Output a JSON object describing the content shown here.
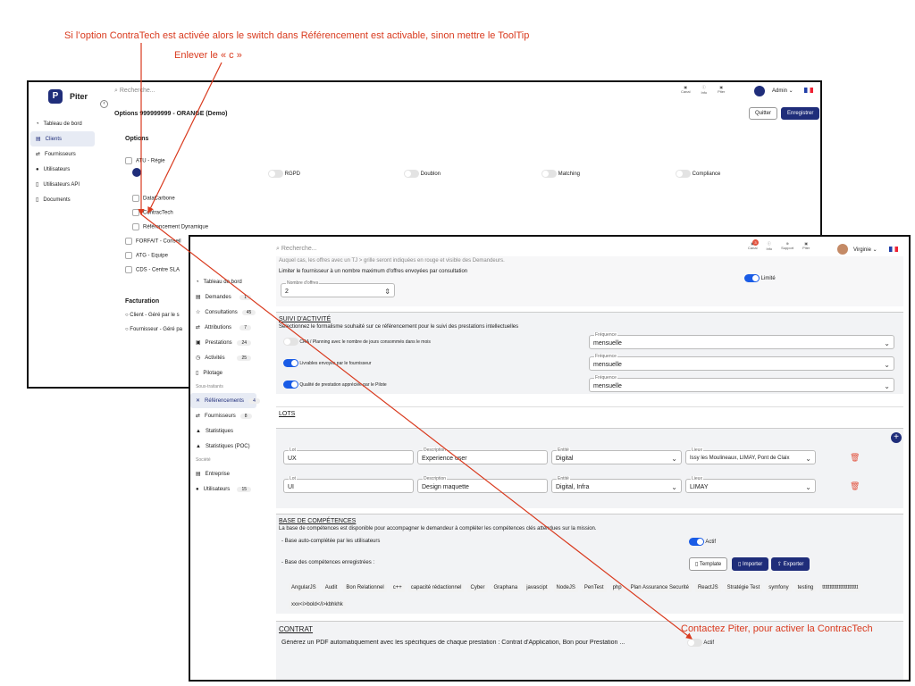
{
  "annotations": {
    "top": "Si l’option ContraTech est activée alors le switch dans Référencement est activable, sinon mettre le ToolTip",
    "second": "Enlever le « c »",
    "contact": "Contactez Piter, pour activer la ContracTech"
  },
  "back": {
    "brand": "Piter",
    "search_placeholder": "Recherche...",
    "header_icons": [
      "Canal",
      "Info",
      "Piter"
    ],
    "user": "Admin",
    "title": "Options 999999999 - ORANGE (Demo)",
    "quit": "Quitter",
    "save": "Enregistrer",
    "nav": [
      "Tableau de bord",
      "Clients",
      "Fournisseurs",
      "Utilisateurs",
      "Utilisateurs API",
      "Documents"
    ],
    "options_title": "Options",
    "atu": "ATU - Régie",
    "toggles": [
      "RGPD",
      "Doublon",
      "Matching",
      "Compliance"
    ],
    "checks": [
      "DataCarbone",
      "ContracTech",
      "Référencement Dynamique"
    ],
    "forfaits": [
      "FORFAIT - Conseil",
      "ATG - Equipe",
      "CDS - Centre SLA"
    ],
    "facturation_title": "Facturation",
    "facturation": [
      "Client - Géré par le s",
      "Fournisseur - Géré pa"
    ]
  },
  "front": {
    "search_placeholder": "Recherche...",
    "header_icons": [
      "Canal",
      "Info",
      "Support",
      "Piter"
    ],
    "canal_count": "3",
    "user": "Virginie",
    "nav_main": [
      {
        "label": "Tableau de bord",
        "count": ""
      },
      {
        "label": "Demandes",
        "count": "1"
      },
      {
        "label": "Consultations",
        "count": "45"
      },
      {
        "label": "Attributions",
        "count": "7"
      },
      {
        "label": "Prestations",
        "count": "24"
      },
      {
        "label": "Activités",
        "count": "25"
      },
      {
        "label": "Pilotage",
        "count": ""
      }
    ],
    "group_sous_traitants": "Sous-traitants",
    "nav_st": [
      {
        "label": "Référencements",
        "count": "4"
      },
      {
        "label": "Fournisseurs",
        "count": "8"
      },
      {
        "label": "Statistiques",
        "count": ""
      },
      {
        "label": "Statistiques (POC)",
        "count": ""
      }
    ],
    "group_societe": "Société",
    "nav_soc": [
      {
        "label": "Entreprise",
        "count": ""
      },
      {
        "label": "Utilisateurs",
        "count": "15"
      }
    ],
    "top_text": "Auquel cas, les offres avec un TJ > grille seront indiquées en rouge et visible des Demandeurs.",
    "limit_text": "Limiter le fournisseur à un nombre maximum d'offres envoyées par consultation",
    "limit_label": "Nombre d'offres",
    "limit_value": "2",
    "limite": "Limité",
    "suivi_title": "SUIVI D'ACTIVITÉ",
    "suivi_sub": "Sélectionnez le formalisme souhaité sur ce référencement pour le suivi des prestations intellectuelles",
    "freq_label": "Fréquence",
    "suivi_rows": [
      {
        "label": "CRA / Planning avec le nombre de jours consommés dans le mois",
        "freq": "mensuelle"
      },
      {
        "label": "Livrables envoyés par le fournisseur",
        "freq": "mensuelle"
      },
      {
        "label": "Qualité de prestation appréciée par le Pilote",
        "freq": "mensuelle"
      }
    ],
    "lots_title": "LOTS",
    "lot_labels": {
      "lot": "Lot",
      "desc": "Description",
      "entite": "Entité",
      "lieux": "Lieux"
    },
    "lots": [
      {
        "lot": "UX",
        "desc": "Experience user",
        "entite": "Digital",
        "lieux": "Issy les Moulineaux, LIMAY, Pont de Claix"
      },
      {
        "lot": "UI",
        "desc": "Design maquette",
        "entite": "Digital, Infra",
        "lieux": "LIMAY"
      }
    ],
    "base_title": "BASE DE COMPÉTENCES",
    "base_sub": "La base de compétences est disponible pour accompagner le demandeur à compléter les compétences clés attendues sur la mission.",
    "auto_label": "- Base auto-complétée par les utilisateurs",
    "actif": "Actif",
    "registered_label": "- Base des compétences enregistrées :",
    "btn_template": "Template",
    "btn_import": "Importer",
    "btn_export": "Exporter",
    "tags": [
      "AngularJS",
      "Audit",
      "Bon Relationnel",
      "c++",
      "capacité rédactionnel",
      "Cyber",
      "Graphana",
      "javascipt",
      "NodeJS",
      "PenTest",
      "php",
      "Plan Assurance Securité",
      "ReactJS",
      "Stratégie Test",
      "symfony",
      "testing",
      "tttttttttttttttttttttttt",
      "xxx<i>bold</i>kbhkhk"
    ],
    "contrat_title": "CONTRAT",
    "contrat_text": "Générez un PDF automatiquement avec les spécifiques de chaque prestation : Contrat d'Application, Bon pour Prestation ...",
    "contrat_actif": "Actif"
  },
  "colors": {
    "annotation": "#d93a1e",
    "brand": "#1f2d7a",
    "toggle_on": "#1a5ce6",
    "delete": "#e2533f"
  }
}
